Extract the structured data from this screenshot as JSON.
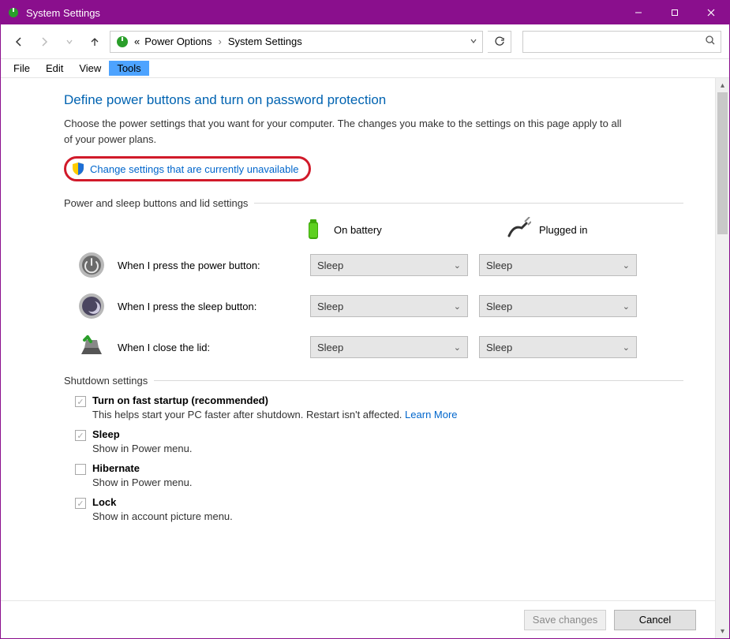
{
  "window": {
    "title": "System Settings"
  },
  "breadcrumb": {
    "prefix": "«",
    "items": [
      "Power Options",
      "System Settings"
    ]
  },
  "menubar": {
    "items": [
      "File",
      "Edit",
      "View",
      "Tools"
    ],
    "active_index": 3
  },
  "page": {
    "heading": "Define power buttons and turn on password protection",
    "description": "Choose the power settings that you want for your computer. The changes you make to the settings on this page apply to all of your power plans.",
    "admin_link": "Change settings that are currently unavailable"
  },
  "sections": {
    "buttons_lid": {
      "title": "Power and sleep buttons and lid settings",
      "columns": [
        "On battery",
        "Plugged in"
      ],
      "rows": [
        {
          "label": "When I press the power button:",
          "battery": "Sleep",
          "plugged": "Sleep"
        },
        {
          "label": "When I press the sleep button:",
          "battery": "Sleep",
          "plugged": "Sleep"
        },
        {
          "label": "When I close the lid:",
          "battery": "Sleep",
          "plugged": "Sleep"
        }
      ]
    },
    "shutdown": {
      "title": "Shutdown settings",
      "items": [
        {
          "label": "Turn on fast startup (recommended)",
          "checked": true,
          "sub": "This helps start your PC faster after shutdown. Restart isn't affected.",
          "learn_more": "Learn More"
        },
        {
          "label": "Sleep",
          "checked": true,
          "sub": "Show in Power menu."
        },
        {
          "label": "Hibernate",
          "checked": false,
          "sub": "Show in Power menu."
        },
        {
          "label": "Lock",
          "checked": true,
          "sub": "Show in account picture menu."
        }
      ]
    }
  },
  "footer": {
    "save": "Save changes",
    "cancel": "Cancel"
  },
  "search": {
    "placeholder": ""
  }
}
